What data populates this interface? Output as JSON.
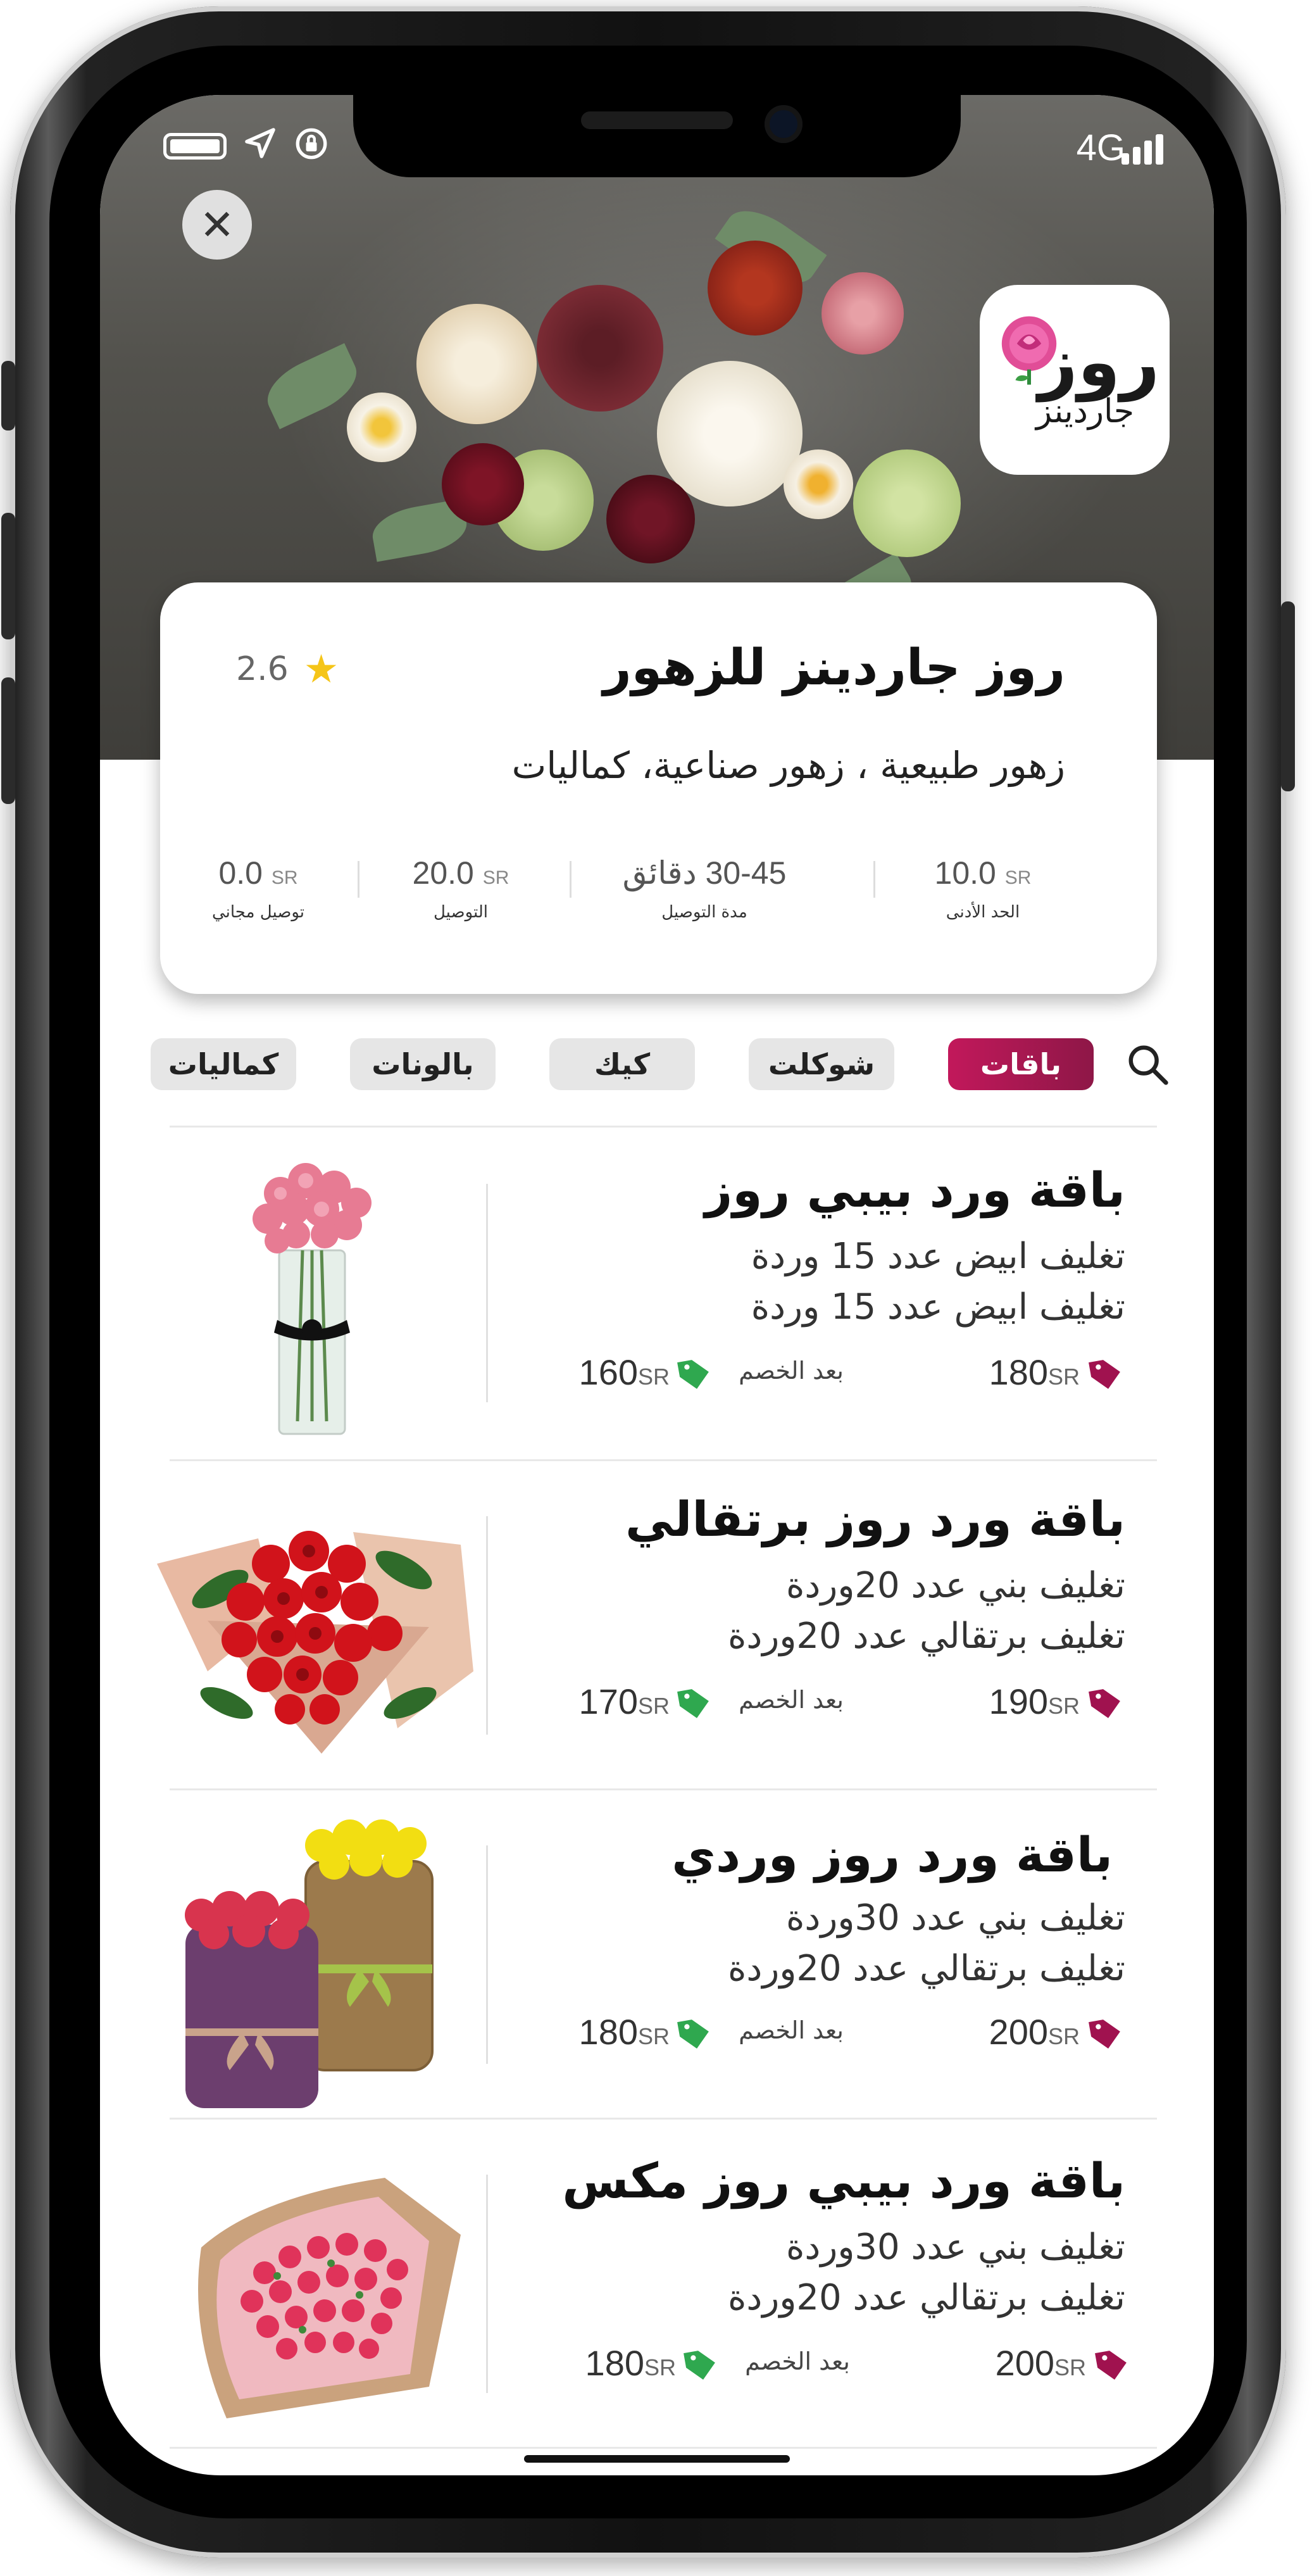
{
  "status_bar": {
    "network": "4G"
  },
  "store": {
    "name": "روز جاردينز للزهور",
    "rating": "2.6",
    "tags": "زهور طبيعية ، زهور صناعية، كماليات",
    "logo_text_main": "روز",
    "logo_text_sub": "جاردينز"
  },
  "stats": [
    {
      "value": "10.0",
      "unit": "SR",
      "label": "الحد الأدنى"
    },
    {
      "value": "30-45 دقائق",
      "unit": "",
      "label": "مدة التوصيل"
    },
    {
      "value": "20.0",
      "unit": "SR",
      "label": "التوصيل"
    },
    {
      "value": "0.0",
      "unit": "SR",
      "label": "توصيل مجاني"
    }
  ],
  "categories": [
    "باقات",
    "شوكلت",
    "كيك",
    "بالونات",
    "كماليات"
  ],
  "after_discount_label": "بعد الخصم",
  "currency": "SR",
  "products": [
    {
      "title": "باقة ورد بيبي روز",
      "line1": "تغليف ابيض عدد 15 وردة",
      "line2": "تغليف ابيض عدد 15 وردة",
      "price": "180",
      "discount_price": "160"
    },
    {
      "title": "باقة ورد روز برتقالي",
      "line1": "تغليف بني عدد 20وردة",
      "line2": "تغليف برتقالي عدد 20وردة",
      "price": "190",
      "discount_price": "170"
    },
    {
      "title": "باقة ورد روز وردي",
      "line1": "تغليف بني عدد 30وردة",
      "line2": "تغليف برتقالي عدد 20وردة",
      "price": "200",
      "discount_price": "180"
    },
    {
      "title": "باقة ورد بيبي روز مكس",
      "line1": "تغليف بني عدد 30وردة",
      "line2": "تغليف برتقالي عدد 20وردة",
      "price": "200",
      "discount_price": "180"
    }
  ],
  "colors": {
    "accent": "#c2185b",
    "discount_tag": "#2fa84f",
    "price_tag": "#a0124f",
    "star": "#f5c518"
  },
  "icons": [
    "close-icon",
    "star-icon",
    "search-icon",
    "price-tag-icon",
    "discount-tag-icon",
    "battery-icon",
    "location-arrow-icon",
    "rotation-lock-icon",
    "signal-icon"
  ]
}
